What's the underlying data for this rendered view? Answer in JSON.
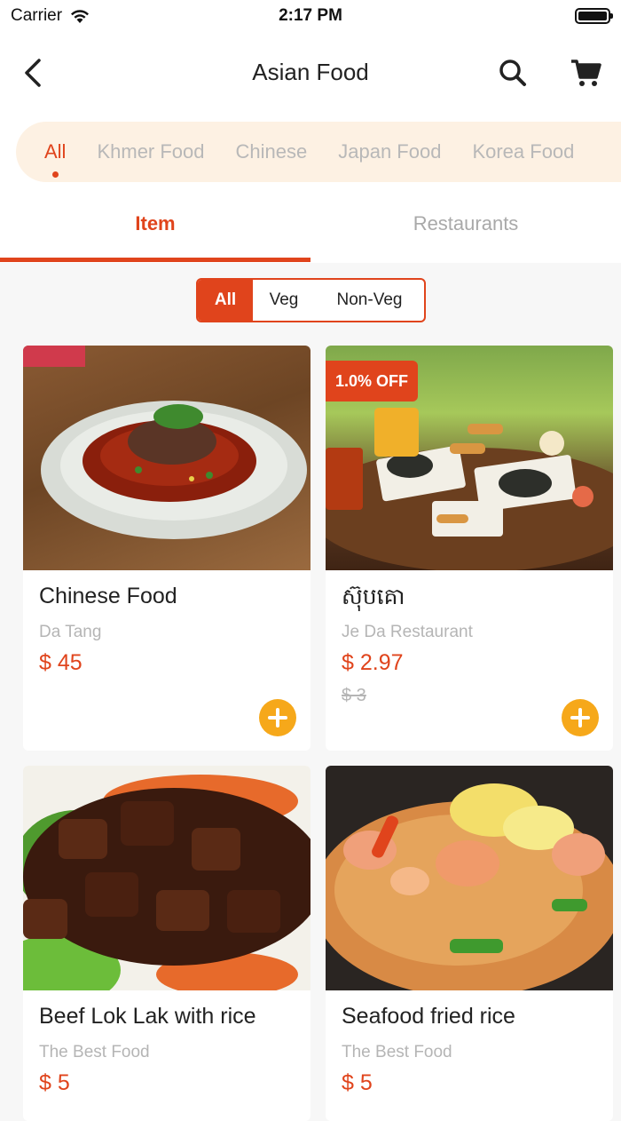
{
  "status_bar": {
    "carrier": "Carrier",
    "time": "2:17 PM"
  },
  "header": {
    "title": "Asian Food",
    "back_icon": "chevron-left-icon",
    "search_icon": "search-icon",
    "cart_icon": "cart-icon"
  },
  "categories": [
    "All",
    "Khmer Food",
    "Chinese",
    "Japan Food",
    "Korea Food"
  ],
  "tabs": {
    "item": "Item",
    "restaurants": "Restaurants"
  },
  "filter": {
    "all": "All",
    "veg": "Veg",
    "non_veg": "Non-Veg"
  },
  "products": [
    {
      "name": "Chinese Food",
      "restaurant": "Da Tang",
      "price": "$ 45"
    },
    {
      "name": "ស៊ុបគោ",
      "restaurant": "Je Da Restaurant",
      "price": "$ 2.97",
      "old_price": "$ 3",
      "badge": "1.0% OFF"
    },
    {
      "name": "Beef Lok Lak with rice",
      "restaurant": "The Best Food",
      "price": "$ 5"
    },
    {
      "name": "Seafood fried rice",
      "restaurant": "The Best Food",
      "price": "$ 5"
    }
  ],
  "colors": {
    "accent": "#e0441c",
    "add_button": "#f6a81a",
    "category_bar": "#fdf1e3"
  }
}
